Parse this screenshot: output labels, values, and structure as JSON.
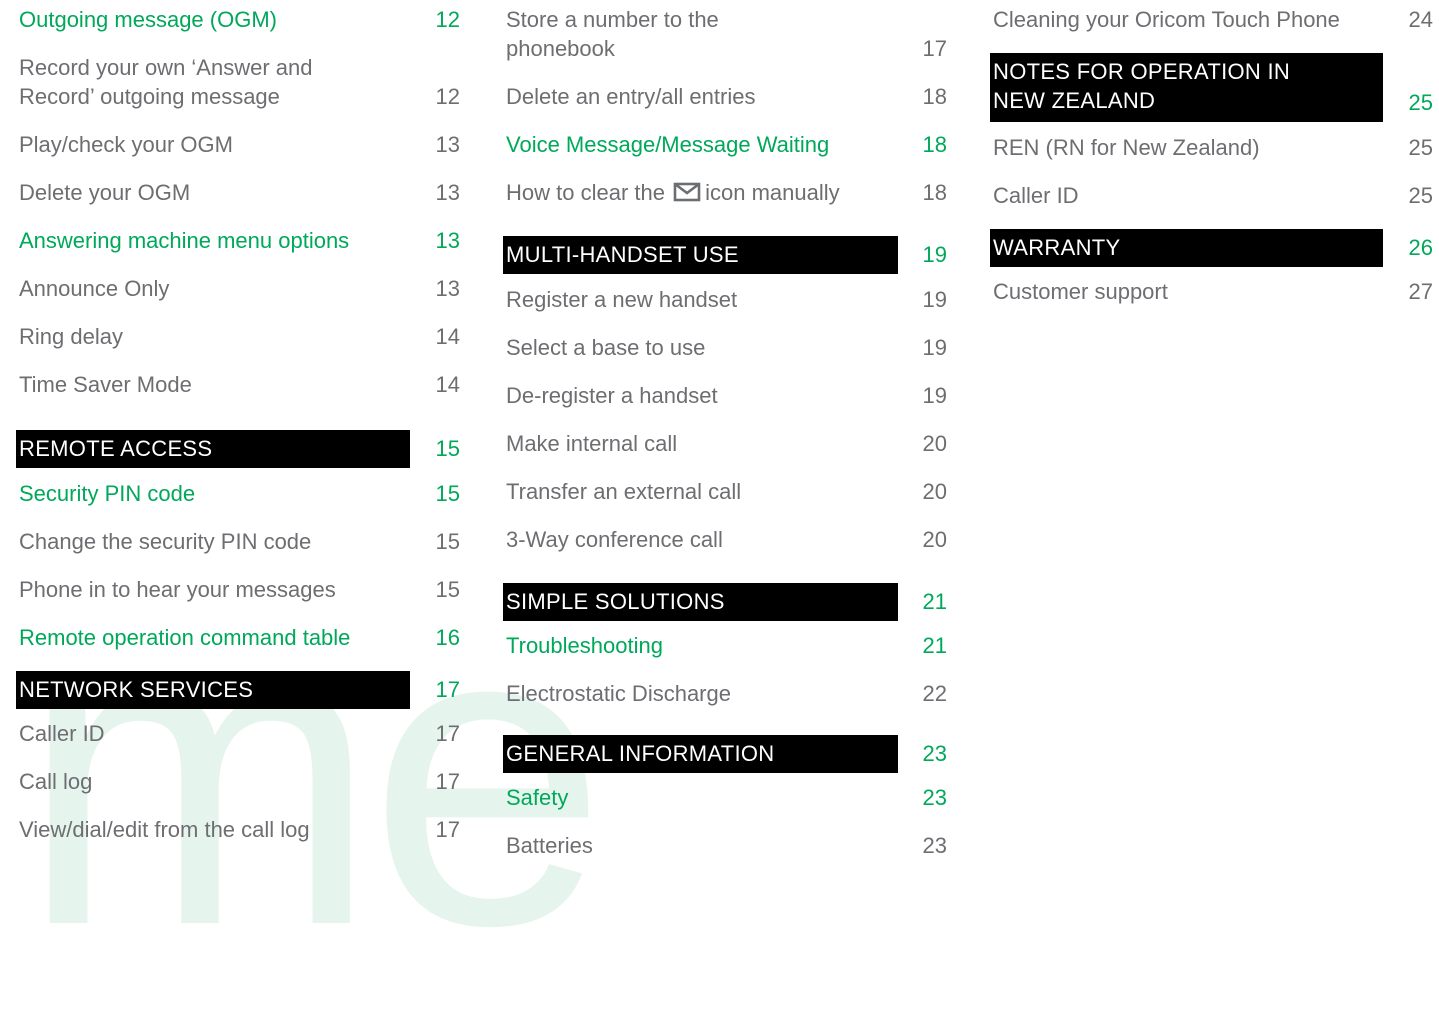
{
  "watermark": "me",
  "col1": [
    {
      "text": "Outgoing message (OGM)",
      "page": "12",
      "style": "green"
    },
    {
      "text": "Record your own ‘Answer and",
      "text2": "Record’ outgoing message",
      "page": "12",
      "style": "normal"
    },
    {
      "text": "Play/check your OGM",
      "page": "13",
      "style": "normal"
    },
    {
      "text": "Delete your OGM",
      "page": "13",
      "style": "normal"
    },
    {
      "text": "Answering machine menu options",
      "page": "13",
      "style": "green"
    },
    {
      "text": "Announce Only",
      "page": "13",
      "style": "normal"
    },
    {
      "text": "Ring delay",
      "page": "14",
      "style": "normal"
    },
    {
      "text": "Time Saver Mode",
      "page": "14",
      "style": "normal"
    },
    {
      "text": "REMOTE ACCESS",
      "page": "15",
      "style": "header"
    },
    {
      "text": "Security PIN code",
      "page": "15",
      "style": "green"
    },
    {
      "text": "Change the security PIN code",
      "page": "15",
      "style": "normal"
    },
    {
      "text": "Phone in to hear your messages",
      "page": "15",
      "style": "normal"
    },
    {
      "text": "Remote operation command table",
      "page": "16",
      "style": "green"
    },
    {
      "text": "NETWORK SERVICES",
      "page": "17",
      "style": "header"
    },
    {
      "text": "Caller ID",
      "page": "17",
      "style": "normal"
    },
    {
      "text": "Call log",
      "page": "17",
      "style": "normal"
    },
    {
      "text": "View/dial/edit from the call log",
      "page": "17",
      "style": "normal"
    }
  ],
  "col2": [
    {
      "text": "Store a number to the",
      "text2": "phonebook",
      "page": "17",
      "style": "normal"
    },
    {
      "text": "Delete an entry/all entries",
      "page": "18",
      "style": "normal"
    },
    {
      "text": "Voice Message/Message Waiting",
      "page": "18",
      "style": "green"
    },
    {
      "text": "How to clear the",
      "text_after": "icon manually",
      "icon": "envelope-icon",
      "page": "18",
      "style": "normal"
    },
    {
      "text": "MULTI-HANDSET USE",
      "page": "19",
      "style": "header"
    },
    {
      "text": "Register a new handset",
      "page": "19",
      "style": "normal"
    },
    {
      "text": "Select a base to use",
      "page": "19",
      "style": "normal"
    },
    {
      "text": "De-register a handset",
      "page": "19",
      "style": "normal"
    },
    {
      "text": "Make internal call",
      "page": "20",
      "style": "normal"
    },
    {
      "text": "Transfer an external call",
      "page": "20",
      "style": "normal"
    },
    {
      "text": "3-Way conference call",
      "page": "20",
      "style": "normal"
    },
    {
      "text": "SIMPLE SOLUTIONS",
      "page": "21",
      "style": "header"
    },
    {
      "text": "Troubleshooting",
      "page": "21",
      "style": "green"
    },
    {
      "text": "Electrostatic Discharge",
      "page": "22",
      "style": "normal"
    },
    {
      "text": "GENERAL INFORMATION",
      "page": "23",
      "style": "header"
    },
    {
      "text": "Safety",
      "page": "23",
      "style": "green"
    },
    {
      "text": "Batteries",
      "page": "23",
      "style": "normal"
    }
  ],
  "col3": [
    {
      "text": "Cleaning your Oricom Touch Phone",
      "page": "24",
      "style": "normal"
    },
    {
      "text": "NOTES FOR OPERATION IN",
      "text2": "NEW ZEALAND",
      "page": "25",
      "style": "header"
    },
    {
      "text": "REN (RN for New Zealand)",
      "page": "25",
      "style": "normal"
    },
    {
      "text": "Caller ID",
      "page": "25",
      "style": "normal"
    },
    {
      "text": "WARRANTY",
      "page": "26",
      "style": "header"
    },
    {
      "text": "Customer support",
      "page": "27",
      "style": "normal"
    }
  ],
  "colors": {
    "green": "#00a85a",
    "gray": "#6d6e71",
    "header_bg": "#000000",
    "watermark": "#e6f4ee"
  }
}
